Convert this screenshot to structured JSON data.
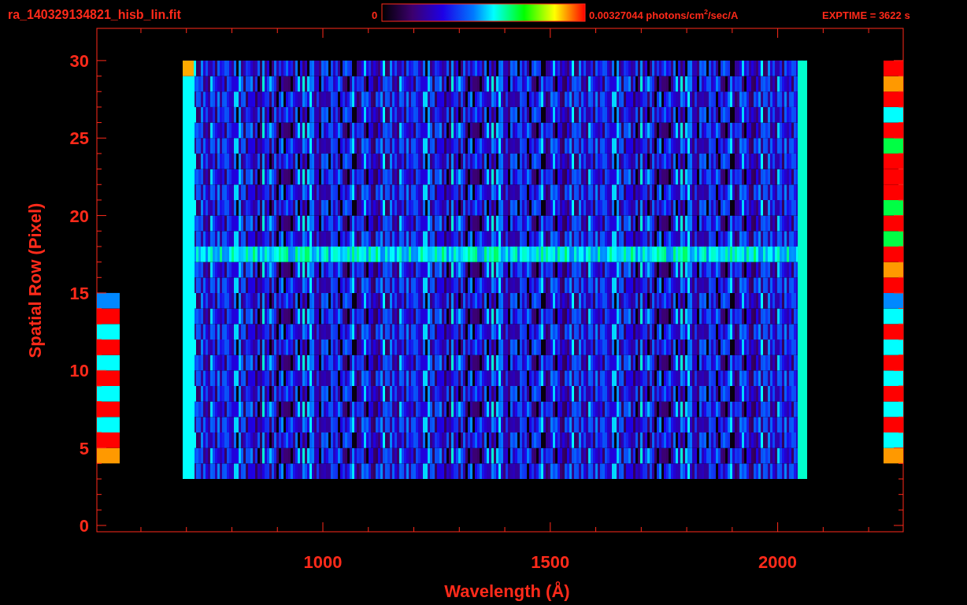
{
  "header": {
    "filename": "ra_140329134821_hisb_lin.fit",
    "colorbar_min": "0",
    "colorbar_max": "0.00327044 photons/cm$^{2}$/sec/A",
    "exposure": "EXPTIME = 3622 s"
  },
  "y_axis": {
    "label": "Spatial Row (Pixel)",
    "ticks": [
      "30",
      "25",
      "20",
      "15",
      "10",
      "5",
      "0"
    ]
  },
  "x_axis": {
    "label": "Wavelength (Å)",
    "ticks": [
      "1000",
      "1500",
      "2000"
    ]
  }
}
